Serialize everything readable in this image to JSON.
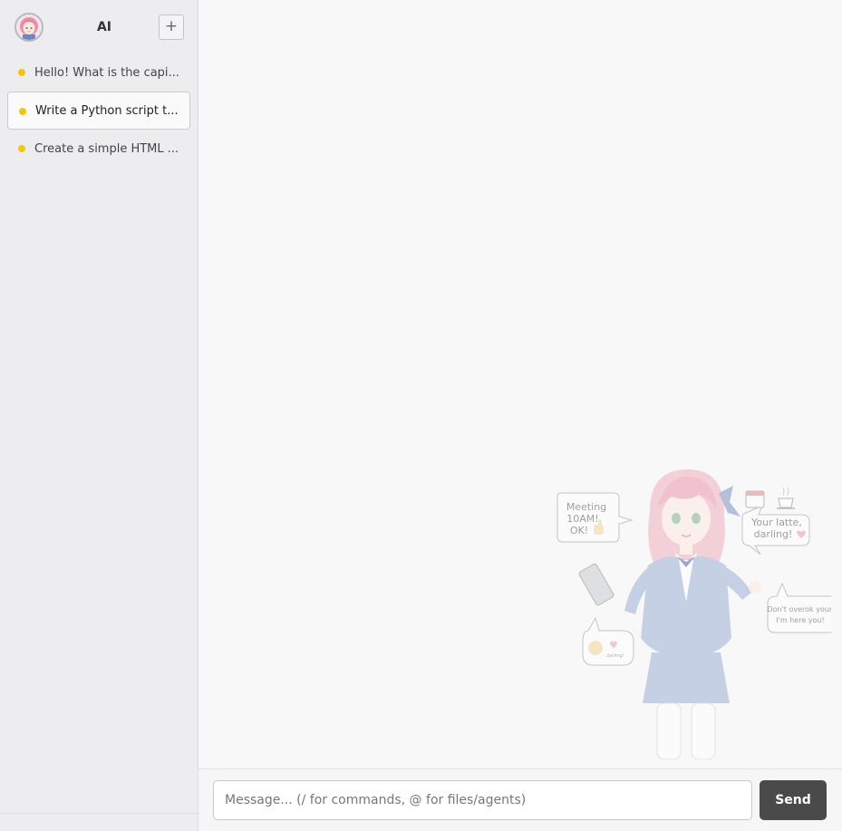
{
  "sidebar": {
    "title": "AI",
    "new_chat_label": "+",
    "conversations": [
      {
        "title": "Hello! What is the capi...",
        "status_color": "#f3c414",
        "active": false
      },
      {
        "title": "Write a Python script t...",
        "status_color": "#f3c414",
        "active": true
      },
      {
        "title": "Create a simple HTML ...",
        "status_color": "#f3c414",
        "active": false
      }
    ]
  },
  "mascot": {
    "bubbles": [
      {
        "text": "Meeting 10AM! OK!",
        "icon": "thumbs-up-icon"
      },
      {
        "text": "Your latte, darling!",
        "icon": "heart-icon"
      },
      {
        "text": "Don't overok yourself! I'm here you!",
        "icon": "smile-icon"
      },
      {
        "text": "darling!",
        "icon": "heart-icon"
      }
    ]
  },
  "composer": {
    "placeholder": "Message... (/ for commands, @ for files/agents)",
    "value": "",
    "send_label": "Send"
  },
  "colors": {
    "accent": "#4a4a4a",
    "status_dot": "#f3c414",
    "sidebar_bg": "#ededef",
    "main_bg": "#f8f8f8"
  }
}
